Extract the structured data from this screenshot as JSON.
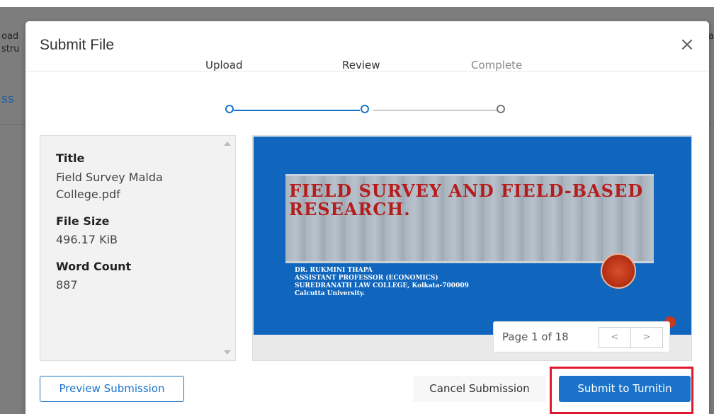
{
  "background": {
    "fragments": [
      "oad",
      "stru",
      "ss",
      "a"
    ]
  },
  "modal": {
    "title": "Submit File",
    "close_label": "×"
  },
  "stepper": {
    "steps": [
      {
        "label": "Upload",
        "state": "done"
      },
      {
        "label": "Review",
        "state": "active"
      },
      {
        "label": "Complete",
        "state": "pending"
      }
    ],
    "active_color": "#1a73c9",
    "inactive_color": "#cccccc"
  },
  "file_info": {
    "title_label": "Title",
    "title_value": "Field Survey Malda College.pdf",
    "size_label": "File Size",
    "size_value": "496.17 KiB",
    "words_label": "Word Count",
    "words_value": "887"
  },
  "preview": {
    "slide_title": "FIELD SURVEY AND FIELD-BASED RESEARCH.",
    "author_lines": [
      "DR. RUKMINI THAPA",
      "ASSISTANT PROFESSOR (ECONOMICS)",
      "SUREDRANATH LAW COLLEGE, Kolkata-700009",
      "Calcutta University."
    ],
    "page_text": "Page 1 of 18",
    "prev_label": "<",
    "next_label": ">"
  },
  "actions": {
    "preview_label": "Preview Submission",
    "cancel_label": "Cancel Submission",
    "submit_label": "Submit to Turnitin"
  },
  "colors": {
    "primary": "#1a73c9",
    "highlight": "#e0192e",
    "slide_bg": "#1066bd"
  }
}
